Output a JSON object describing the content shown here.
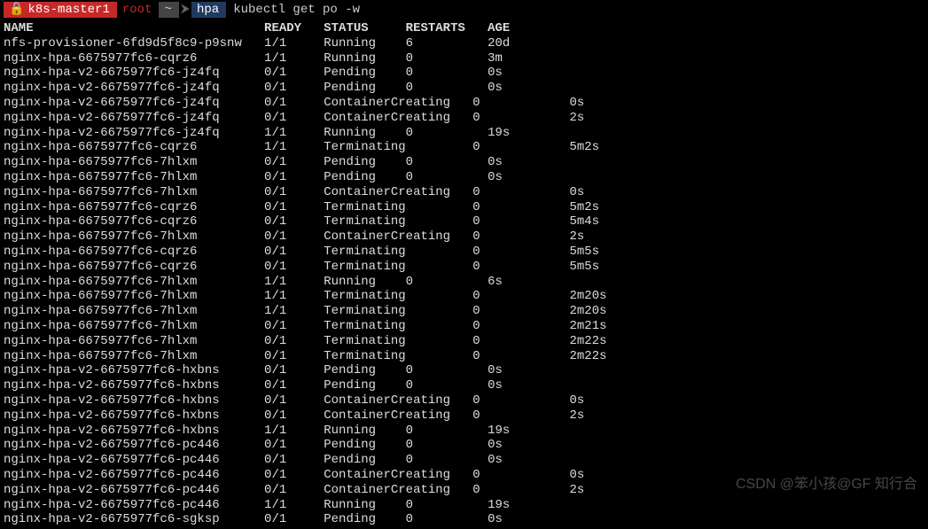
{
  "prompt": {
    "lock_icon": "🔒",
    "host": "k8s-master1",
    "user": "root",
    "path_sep1": "~",
    "path_sep2": "hpa",
    "arrow": "⮞",
    "command": "kubectl get po -w"
  },
  "headers": {
    "name": "NAME",
    "ready": "READY",
    "status": "STATUS",
    "restarts": "RESTARTS",
    "age": "AGE"
  },
  "rows": [
    {
      "name": "nfs-provisioner-6fd9d5f8c9-p9snw",
      "ready": "1/1",
      "status": "Running",
      "restarts": "6",
      "age": "20d"
    },
    {
      "name": "nginx-hpa-6675977fc6-cqrz6",
      "ready": "1/1",
      "status": "Running",
      "restarts": "0",
      "age": "3m"
    },
    {
      "name": "nginx-hpa-v2-6675977fc6-jz4fq",
      "ready": "0/1",
      "status": "Pending",
      "restarts": "0",
      "age": "0s"
    },
    {
      "name": "nginx-hpa-v2-6675977fc6-jz4fq",
      "ready": "0/1",
      "status": "Pending",
      "restarts": "0",
      "age": "0s"
    },
    {
      "name": "nginx-hpa-v2-6675977fc6-jz4fq",
      "ready": "0/1",
      "status": "ContainerCreating",
      "restarts": "0",
      "age": "0s"
    },
    {
      "name": "nginx-hpa-v2-6675977fc6-jz4fq",
      "ready": "0/1",
      "status": "ContainerCreating",
      "restarts": "0",
      "age": "2s"
    },
    {
      "name": "nginx-hpa-v2-6675977fc6-jz4fq",
      "ready": "1/1",
      "status": "Running",
      "restarts": "0",
      "age": "19s"
    },
    {
      "name": "nginx-hpa-6675977fc6-cqrz6",
      "ready": "1/1",
      "status": "Terminating",
      "restarts": "0",
      "age": "5m2s"
    },
    {
      "name": "nginx-hpa-6675977fc6-7hlxm",
      "ready": "0/1",
      "status": "Pending",
      "restarts": "0",
      "age": "0s"
    },
    {
      "name": "nginx-hpa-6675977fc6-7hlxm",
      "ready": "0/1",
      "status": "Pending",
      "restarts": "0",
      "age": "0s"
    },
    {
      "name": "nginx-hpa-6675977fc6-7hlxm",
      "ready": "0/1",
      "status": "ContainerCreating",
      "restarts": "0",
      "age": "0s"
    },
    {
      "name": "nginx-hpa-6675977fc6-cqrz6",
      "ready": "0/1",
      "status": "Terminating",
      "restarts": "0",
      "age": "5m2s"
    },
    {
      "name": "nginx-hpa-6675977fc6-cqrz6",
      "ready": "0/1",
      "status": "Terminating",
      "restarts": "0",
      "age": "5m4s"
    },
    {
      "name": "nginx-hpa-6675977fc6-7hlxm",
      "ready": "0/1",
      "status": "ContainerCreating",
      "restarts": "0",
      "age": "2s"
    },
    {
      "name": "nginx-hpa-6675977fc6-cqrz6",
      "ready": "0/1",
      "status": "Terminating",
      "restarts": "0",
      "age": "5m5s"
    },
    {
      "name": "nginx-hpa-6675977fc6-cqrz6",
      "ready": "0/1",
      "status": "Terminating",
      "restarts": "0",
      "age": "5m5s"
    },
    {
      "name": "nginx-hpa-6675977fc6-7hlxm",
      "ready": "1/1",
      "status": "Running",
      "restarts": "0",
      "age": "6s"
    },
    {
      "name": "nginx-hpa-6675977fc6-7hlxm",
      "ready": "1/1",
      "status": "Terminating",
      "restarts": "0",
      "age": "2m20s"
    },
    {
      "name": "nginx-hpa-6675977fc6-7hlxm",
      "ready": "1/1",
      "status": "Terminating",
      "restarts": "0",
      "age": "2m20s"
    },
    {
      "name": "nginx-hpa-6675977fc6-7hlxm",
      "ready": "0/1",
      "status": "Terminating",
      "restarts": "0",
      "age": "2m21s"
    },
    {
      "name": "nginx-hpa-6675977fc6-7hlxm",
      "ready": "0/1",
      "status": "Terminating",
      "restarts": "0",
      "age": "2m22s"
    },
    {
      "name": "nginx-hpa-6675977fc6-7hlxm",
      "ready": "0/1",
      "status": "Terminating",
      "restarts": "0",
      "age": "2m22s"
    },
    {
      "name": "nginx-hpa-v2-6675977fc6-hxbns",
      "ready": "0/1",
      "status": "Pending",
      "restarts": "0",
      "age": "0s"
    },
    {
      "name": "nginx-hpa-v2-6675977fc6-hxbns",
      "ready": "0/1",
      "status": "Pending",
      "restarts": "0",
      "age": "0s"
    },
    {
      "name": "nginx-hpa-v2-6675977fc6-hxbns",
      "ready": "0/1",
      "status": "ContainerCreating",
      "restarts": "0",
      "age": "0s"
    },
    {
      "name": "nginx-hpa-v2-6675977fc6-hxbns",
      "ready": "0/1",
      "status": "ContainerCreating",
      "restarts": "0",
      "age": "2s"
    },
    {
      "name": "nginx-hpa-v2-6675977fc6-hxbns",
      "ready": "1/1",
      "status": "Running",
      "restarts": "0",
      "age": "19s"
    },
    {
      "name": "nginx-hpa-v2-6675977fc6-pc446",
      "ready": "0/1",
      "status": "Pending",
      "restarts": "0",
      "age": "0s"
    },
    {
      "name": "nginx-hpa-v2-6675977fc6-pc446",
      "ready": "0/1",
      "status": "Pending",
      "restarts": "0",
      "age": "0s"
    },
    {
      "name": "nginx-hpa-v2-6675977fc6-pc446",
      "ready": "0/1",
      "status": "ContainerCreating",
      "restarts": "0",
      "age": "0s"
    },
    {
      "name": "nginx-hpa-v2-6675977fc6-pc446",
      "ready": "0/1",
      "status": "ContainerCreating",
      "restarts": "0",
      "age": "2s"
    },
    {
      "name": "nginx-hpa-v2-6675977fc6-pc446",
      "ready": "1/1",
      "status": "Running",
      "restarts": "0",
      "age": "19s"
    },
    {
      "name": "nginx-hpa-v2-6675977fc6-sgksp",
      "ready": "0/1",
      "status": "Pending",
      "restarts": "0",
      "age": "0s"
    }
  ],
  "watermark": "CSDN @笨小孩@GF 知行合"
}
